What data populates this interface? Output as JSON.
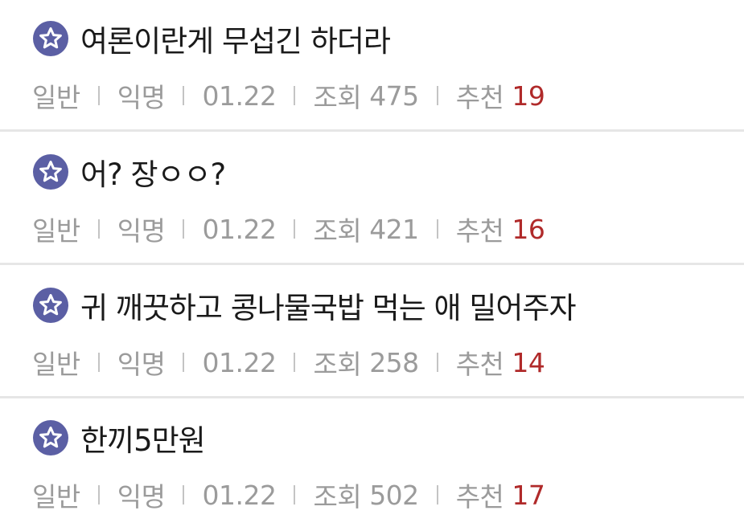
{
  "colors": {
    "star_badge": "#5b5fa4",
    "recommend_count": "#b02a2a",
    "meta_text": "#9b9b9b"
  },
  "posts": [
    {
      "icon": "star-icon",
      "title": "여론이란게 무섭긴 하더라",
      "category": "일반",
      "author": "익명",
      "date": "01.22",
      "views_label": "조회",
      "views": "475",
      "recommend_label": "추천",
      "recommend": "19"
    },
    {
      "icon": "star-icon",
      "title": "어? 장ㅇㅇ?",
      "category": "일반",
      "author": "익명",
      "date": "01.22",
      "views_label": "조회",
      "views": "421",
      "recommend_label": "추천",
      "recommend": "16"
    },
    {
      "icon": "star-icon",
      "title": "귀 깨끗하고 콩나물국밥 먹는 애 밀어주자",
      "category": "일반",
      "author": "익명",
      "date": "01.22",
      "views_label": "조회",
      "views": "258",
      "recommend_label": "추천",
      "recommend": "14"
    },
    {
      "icon": "star-icon",
      "title": "한끼5만원",
      "category": "일반",
      "author": "익명",
      "date": "01.22",
      "views_label": "조회",
      "views": "502",
      "recommend_label": "추천",
      "recommend": "17"
    }
  ]
}
